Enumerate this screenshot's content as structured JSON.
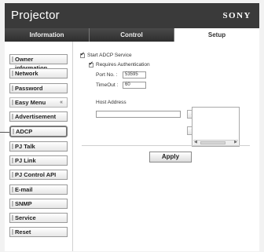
{
  "app": {
    "title": "Projector",
    "brand": "SONY"
  },
  "tabs": [
    {
      "label": "Information"
    },
    {
      "label": "Control"
    },
    {
      "label": "Setup"
    }
  ],
  "sidebar": {
    "items": [
      {
        "label": "Owner information"
      },
      {
        "label": "Network"
      },
      {
        "label": "Password"
      },
      {
        "label": "Easy Menu",
        "chevron": "«"
      },
      {
        "label": "Advertisement"
      },
      {
        "label": "ADCP"
      },
      {
        "label": "PJ Talk"
      },
      {
        "label": "PJ Link"
      },
      {
        "label": "PJ Control API"
      },
      {
        "label": "E-mail"
      },
      {
        "label": "SNMP"
      },
      {
        "label": "Service"
      },
      {
        "label": "Reset"
      }
    ]
  },
  "adcp": {
    "start_service_label": "Start ADCP Service",
    "requires_auth_label": "Requires Authentication",
    "port_label": "Port No. :",
    "port_value": "53595",
    "timeout_label": "TimeOut :",
    "timeout_value": "60",
    "host_address_label": "Host Address",
    "host_address_value": "",
    "add_button": ">>",
    "remove_button": "<<",
    "apply_button": "Apply"
  }
}
